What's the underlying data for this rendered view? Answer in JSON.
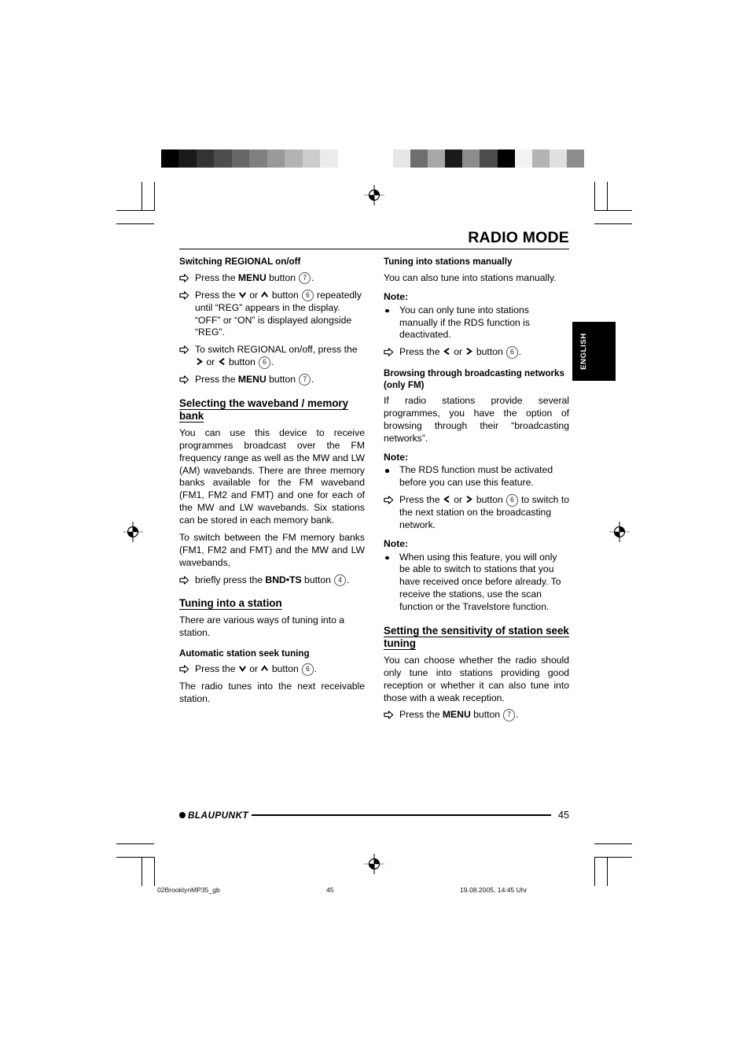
{
  "page": {
    "title": "RADIO MODE",
    "number": "45",
    "side_tab": "ENGLISH",
    "brand": "BLAUPUNKT"
  },
  "print_meta": {
    "file": "02BrooklynMP35_gb",
    "page": "45",
    "date": "19.08.2005, 14:45 Uhr"
  },
  "calibration": {
    "left_bar": [
      "#000000",
      "#1a1a1a",
      "#333333",
      "#4d4d4d",
      "#666666",
      "#808080",
      "#999999",
      "#b3b3b3",
      "#cccccc",
      "#ececec",
      "#ffffff"
    ],
    "right_bar": [
      "#e6e6e6",
      "#6e6e6e",
      "#a8a8a8",
      "#1a1a1a",
      "#8c8c8c",
      "#4d4d4d",
      "#000000",
      "#f2f2f2",
      "#b3b3b3",
      "#e0e0e0",
      "#8c8c8c"
    ]
  },
  "left_column": {
    "h_switching_regional": "Switching REGIONAL on/off",
    "step_1_a": "Press the ",
    "step_1_b": "MENU",
    "step_1_c": " button ",
    "step_1_num": "7",
    "step_1_d": ".",
    "step_2_a": "Press the ",
    "step_2_mid": " or ",
    "step_2_b": " button ",
    "step_2_num": "6",
    "step_2_c": " repeatedly until “REG” appears in the display. “OFF” or “ON” is displayed alongside “REG”.",
    "step_3_a": "To switch REGIONAL on/off, press the ",
    "step_3_mid": " or ",
    "step_3_b": " button ",
    "step_3_num": "6",
    "step_3_c": ".",
    "step_4_a": "Press the ",
    "step_4_b": "MENU",
    "step_4_c": " button ",
    "step_4_num": "7",
    "step_4_d": ".",
    "h_selecting_waveband": "Selecting the waveband / memory bank",
    "p_waveband_1": "You can use this device to receive programmes broadcast over the FM frequency range as well as the MW and LW (AM) wavebands. There are three memory banks available for the FM waveband (FM1, FM2 and FMT) and one for each of the MW and LW wavebands. Six stations can be stored in each memory bank.",
    "p_waveband_2": "To switch between the FM memory banks (FM1, FM2 and FMT) and the MW and LW wavebands,",
    "step_bndts_a": "briefly press the ",
    "step_bndts_b": "BND•TS",
    "step_bndts_c": " button ",
    "step_bndts_num": "4",
    "step_bndts_d": ".",
    "h_tuning_station": "Tuning into a station",
    "p_tuning_station": "There are various ways of tuning into a station.",
    "h_auto_seek": "Automatic station seek tuning",
    "step_seek_a": "Press the ",
    "step_seek_mid": " or ",
    "step_seek_b": " button ",
    "step_seek_num": "6",
    "step_seek_c": ".",
    "p_seek_result": "The radio tunes into the next receivable station."
  },
  "right_column": {
    "h_tuning_manual": "Tuning into stations manually",
    "p_tuning_manual": "You can also tune into stations manually.",
    "note_label_1": "Note:",
    "note_1": "You can only tune into stations manually if the RDS function is deactivated.",
    "step_manual_a": "Press the ",
    "step_manual_mid": " or ",
    "step_manual_b": " button ",
    "step_manual_num": "6",
    "step_manual_c": ".",
    "h_browsing": "Browsing through broadcasting networks (only FM)",
    "p_browsing": "If radio stations provide several programmes, you have the option of browsing through their “broadcasting networks”.",
    "note_label_2": "Note:",
    "note_2": "The RDS function must be activated before you can use this feature.",
    "step_browse_a": "Press the ",
    "step_browse_mid": " or ",
    "step_browse_b": " button ",
    "step_browse_num": "6",
    "step_browse_c": " to switch to the next station on the broadcasting network.",
    "note_label_3": "Note:",
    "note_3": "When using this feature, you will only be able to switch to stations that you have received once before already. To receive the stations, use the scan function or the Travelstore function.",
    "h_sensitivity": "Setting the sensitivity of station seek tuning",
    "p_sensitivity": "You can choose whether the radio should only tune into stations providing good reception or whether it can also tune into those with a weak reception.",
    "step_sens_a": "Press the ",
    "step_sens_b": "MENU",
    "step_sens_c": " button ",
    "step_sens_num": "7",
    "step_sens_d": "."
  }
}
